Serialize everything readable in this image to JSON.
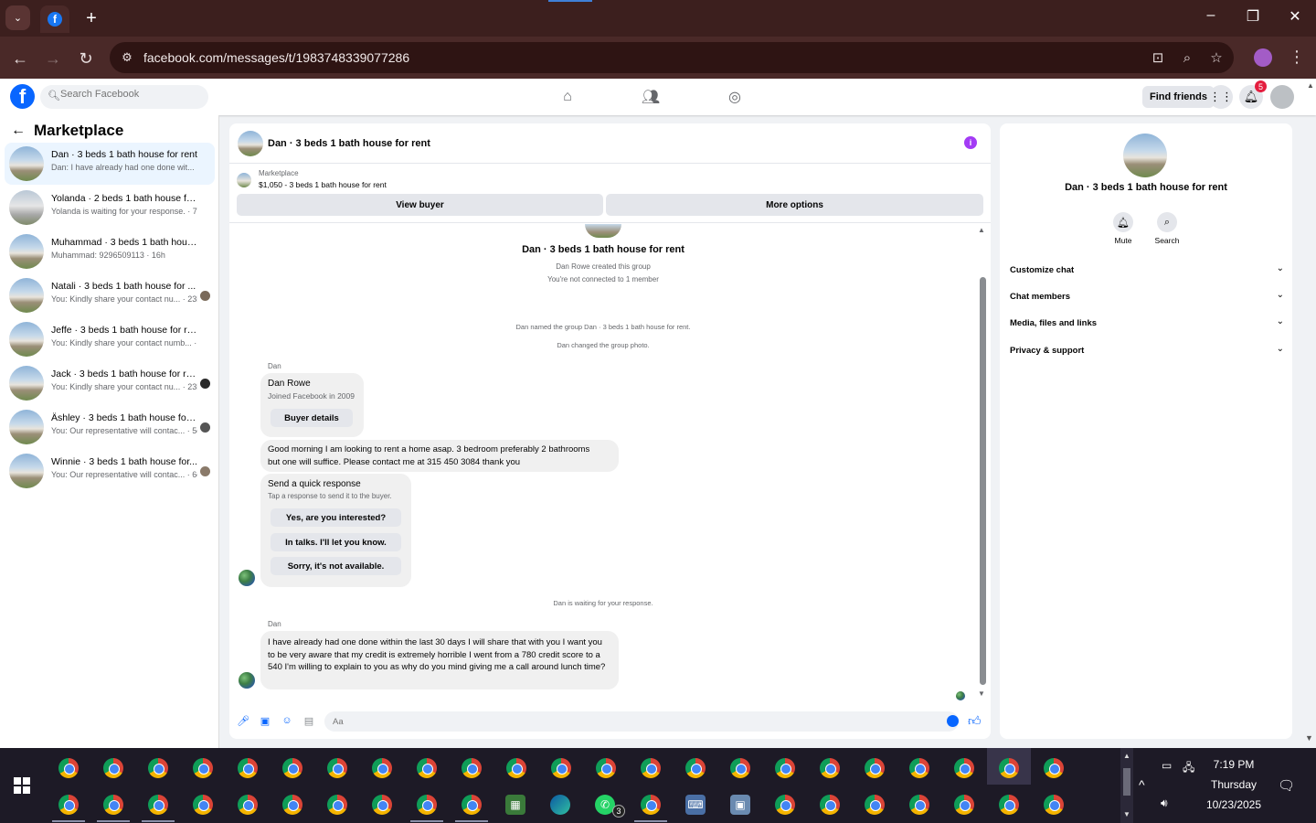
{
  "browser": {
    "url": "facebook.com/messages/t/1983748339077286"
  },
  "fb": {
    "search_placeholder": "Search Facebook",
    "find_friends": "Find friends",
    "notification_count": "5"
  },
  "sidebar": {
    "title": "Marketplace",
    "conversations": [
      {
        "name": "Dan · 3 beds 1 bath house for rent",
        "preview": "Dan: I have already had one done wit... · 4m"
      },
      {
        "name": "Yolanda · 2 beds 1 bath house for r...",
        "preview": "Yolanda is waiting for your response. · 7h"
      },
      {
        "name": "Muhammad · 3 beds 1 bath house ...",
        "preview": "Muhammad: 9296509113 · 16h"
      },
      {
        "name": "Natali · 3 beds 1 bath house for ...",
        "preview": "You: Kindly share your contact nu... · 23h"
      },
      {
        "name": "Jeffe · 3 beds 1 bath house for rent",
        "preview": "You: Kindly share your contact numb... · 23h"
      },
      {
        "name": "Jack · 3 beds 1 bath house for rent",
        "preview": "You: Kindly share your contact nu... · 23h"
      },
      {
        "name": "Äshley · 3 beds 1 bath house for ...",
        "preview": "You: Our representative will contac... · 5d"
      },
      {
        "name": "Winnie · 3 beds 1 bath house for...",
        "preview": "You: Our representative will contac... · 6d"
      }
    ]
  },
  "chat": {
    "title": "Dan · 3 beds 1 bath house for rent",
    "marketplace_label": "Marketplace",
    "listing": "$1,050 - 3 beds 1 bath house for rent",
    "view_buyer": "View buyer",
    "more_options": "More options",
    "group_title": "Dan · 3 beds 1 bath house for rent",
    "created": "Dan Rowe created this group",
    "not_connected": "You're not connected to 1 member",
    "named": "Dan named the group Dan · 3 beds 1 bath house for rent.",
    "changed_photo": "Dan changed the group photo.",
    "sender1": "Dan",
    "buyer_name": "Dan Rowe",
    "buyer_joined": "Joined Facebook in 2009",
    "buyer_details": "Buyer details",
    "msg1_line1": "Good morning I am looking to rent a home asap. 3 bedroom preferably 2 bathrooms",
    "msg1_line2": "but one will suffice. Please contact me at 315 450 3084 thank you",
    "quick_title": "Send a quick response",
    "quick_sub": "Tap a response to send it to the buyer.",
    "quick1": "Yes, are you interested?",
    "quick2": "In talks. I'll let you know.",
    "quick3": "Sorry, it's not available.",
    "waiting": "Dan is waiting for your response.",
    "sender2": "Dan",
    "msg2": "I have already had one done within the last 30 days I will share that with you I want you to be very aware that my credit is extremely horrible I went from a 780 credit score to a 540 I'm willing to explain to you as why do you mind giving me a call around lunch time?",
    "composer_placeholder": "Aa"
  },
  "details": {
    "title": "Dan · 3 beds 1 bath house for rent",
    "mute": "Mute",
    "search": "Search",
    "sections": [
      "Customize chat",
      "Chat members",
      "Media, files and links",
      "Privacy & support"
    ]
  },
  "taskbar": {
    "whatsapp_badge": "3",
    "time": "7:19 PM",
    "day": "Thursday",
    "date": "10/23/2025"
  }
}
